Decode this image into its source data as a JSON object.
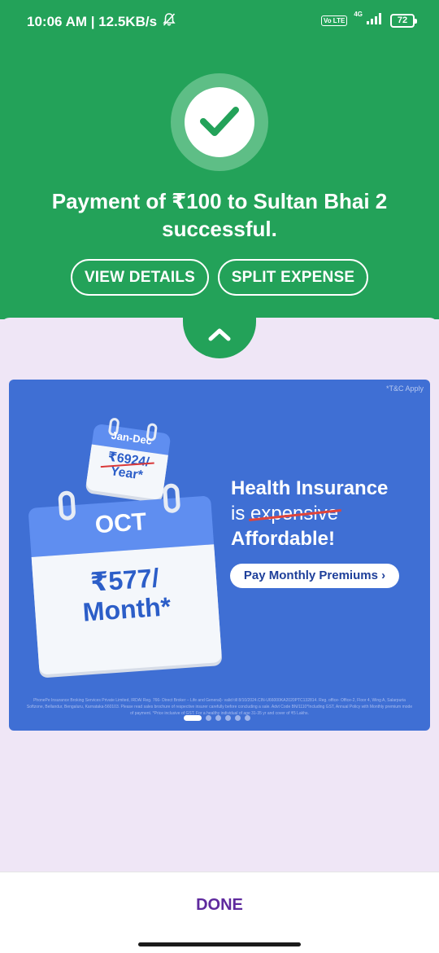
{
  "status_bar": {
    "time_speed": "10:06 AM | 12.5KB/s",
    "volte": "Vo LTE",
    "network": "4G",
    "battery": "72"
  },
  "payment": {
    "title": "Payment of ₹100 to Sultan Bhai 2 successful.",
    "view_details": "VIEW DETAILS",
    "split_expense": "SPLIT EXPENSE"
  },
  "banner": {
    "tc": "*T&C Apply",
    "small_calendar_month": "Jan-Dec",
    "small_calendar_price": "₹6924/",
    "small_calendar_unit": "Year*",
    "big_calendar_month": "OCT",
    "big_calendar_price": "₹577/",
    "big_calendar_unit": "Month*",
    "headline_1": "Health Insurance",
    "headline_2_prefix": "is",
    "headline_2_struck": "expensive",
    "headline_3": "Affordable!",
    "cta": "Pay Monthly Premiums ›",
    "disclaimer": "PhonePe Insurance Broking Services Private Limited, IRDAI Reg. 766- Direct Broker – Life and General)- valid till 8/10/2024.CIN-U66000KA2020PTC132814. Reg. office- Office-2, Floor 4, Wing A, Salarpuria Softzone, Bellandur, Bengaluru, Karnataka-560103. Please read sales brochure of respective insurer carefully before concluding a sale. Advt Code BN/1110*Including GST, Annual Policy with Monthly premium mode of payment. *Price inclusive of GST. For a healthy individual of age 31-35 yr and cover of ₹5 Lakhs.",
    "carousel_total": 6,
    "carousel_active": 0
  },
  "footer": {
    "done": "DONE"
  },
  "colors": {
    "green": "#23a259",
    "banner_blue": "#3f6fd4",
    "done_purple": "#5f2a9e",
    "panel_bg": "#efe6f6"
  }
}
